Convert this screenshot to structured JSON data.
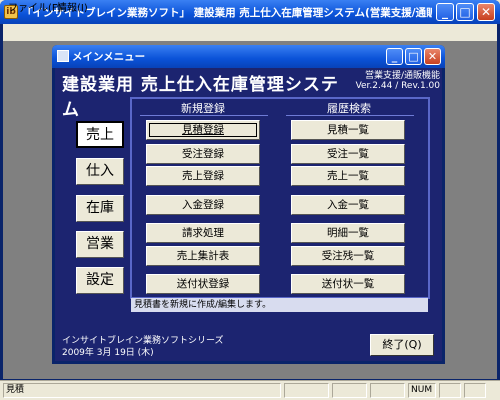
{
  "window": {
    "title": "「インサイトブレイン業務ソフト」 建設業用 売上仕入在庫管理システム(営業支援/通販機能付)",
    "icon_glyph": "ib",
    "minimize_glyph": "_",
    "maximize_glyph": "□",
    "close_glyph": "✕"
  },
  "menubar": {
    "items": [
      {
        "label": "ファイル(F)"
      },
      {
        "label": "情報(I)"
      }
    ]
  },
  "main_menu": {
    "title": "メインメニュー",
    "minimize_glyph": "_",
    "maximize_glyph": "□",
    "close_glyph": "✕"
  },
  "banner": {
    "title": "建設業用 売上仕入在庫管理システム",
    "edition": "営業支援/通販機能",
    "version": "Ver.2.44 / Rev.1.00"
  },
  "side_tabs": [
    {
      "label": "売上",
      "active": true
    },
    {
      "label": "仕入",
      "active": false
    },
    {
      "label": "在庫",
      "active": false
    },
    {
      "label": "営業",
      "active": false
    },
    {
      "label": "設定",
      "active": false
    }
  ],
  "columns": {
    "left_header": "新規登録",
    "right_header": "履歴検索"
  },
  "left_buttons": [
    {
      "label": "見積登録"
    },
    {
      "label": "受注登録"
    },
    {
      "label": "売上登録"
    },
    {
      "label": "入金登録"
    },
    {
      "label": "請求処理"
    },
    {
      "label": "売上集計表"
    },
    {
      "label": "送付状登録"
    }
  ],
  "right_buttons": [
    {
      "label": "見積一覧"
    },
    {
      "label": "受注一覧"
    },
    {
      "label": "売上一覧"
    },
    {
      "label": "入金一覧"
    },
    {
      "label": "明細一覧"
    },
    {
      "label": "受注残一覧"
    },
    {
      "label": "送付状一覧"
    }
  ],
  "status_message": "見積書を新規に作成/編集します。",
  "footer": {
    "series": "インサイトブレイン業務ソフトシリーズ",
    "date": "2009年 3月 19日 (木)",
    "exit_label": "終了(Q)"
  },
  "statusbar": {
    "mode": "見積",
    "num": "NUM"
  },
  "colors": {
    "app_bg": "#1c2470",
    "title_blue": "#0a52d8",
    "panel_border": "#5a67c8"
  }
}
